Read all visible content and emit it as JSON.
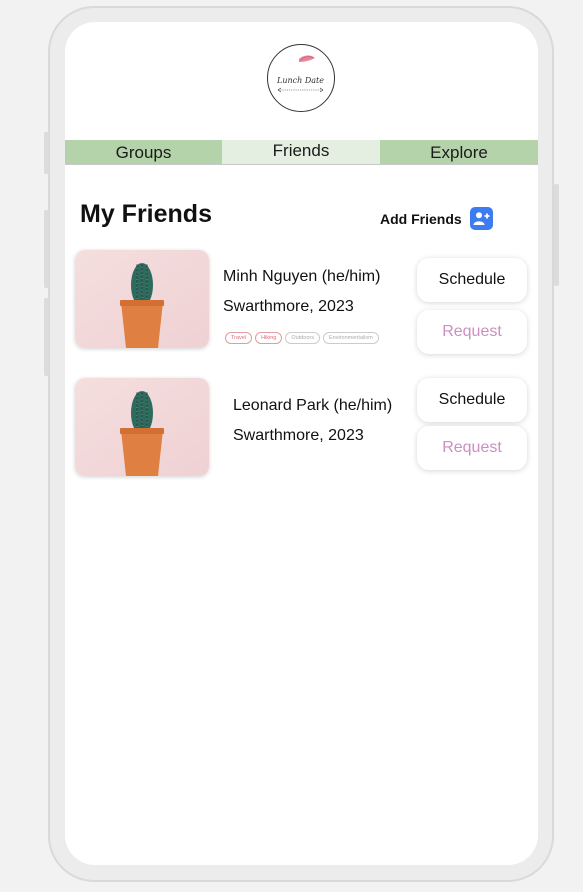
{
  "app": {
    "logo_text": "Lunch Date"
  },
  "tabs": [
    {
      "label": "Groups",
      "active": false
    },
    {
      "label": "Friends",
      "active": true
    },
    {
      "label": "Explore",
      "active": false
    }
  ],
  "page": {
    "title": "My Friends",
    "add_friends_label": "Add Friends"
  },
  "friends": [
    {
      "name": "Minh Nguyen (he/him)",
      "school": "Swarthmore, 2023",
      "tags": [
        "Travel",
        "Hiking",
        "Outdoors",
        "Environmentalism"
      ],
      "schedule_label": "Schedule",
      "request_label": "Request"
    },
    {
      "name": "Leonard Park (he/him)",
      "school": "Swarthmore, 2023",
      "schedule_label": "Schedule",
      "request_label": "Request"
    }
  ],
  "colors": {
    "tab_green": "#b5d3ab",
    "tab_active": "#e4efe2",
    "add_icon_blue": "#3d7cf0",
    "request_text": "#cc8fc1",
    "tag_highlight": "#d96e77"
  },
  "icons": {
    "add_friends": "person-add-icon",
    "friend_photo": "cactus-icon"
  }
}
